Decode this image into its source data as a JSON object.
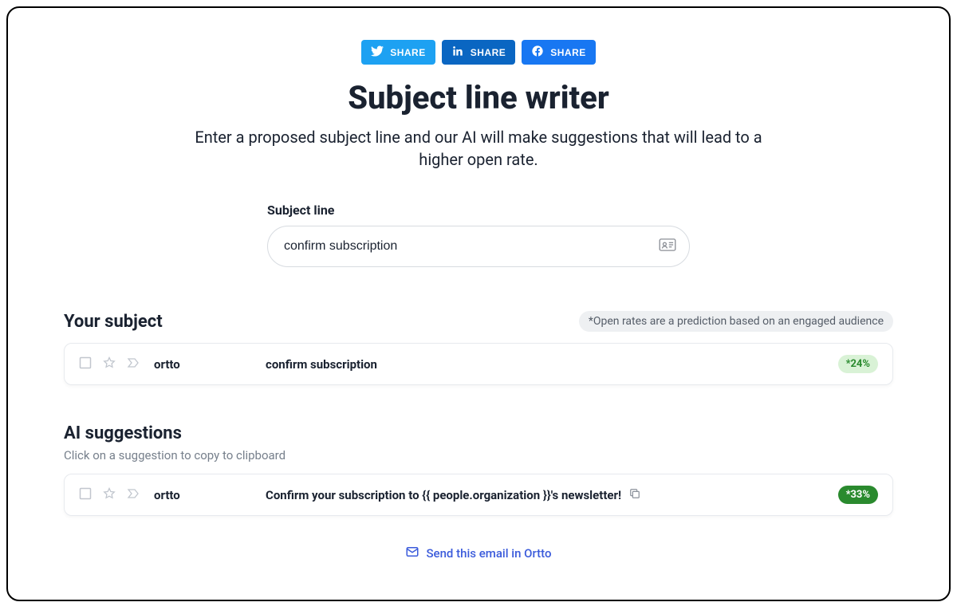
{
  "share": {
    "twitter": "SHARE",
    "linkedin": "SHARE",
    "facebook": "SHARE"
  },
  "header": {
    "title": "Subject line writer",
    "subtitle": "Enter a proposed subject line and our AI will make suggestions that will lead to a higher open rate."
  },
  "input": {
    "label": "Subject line",
    "value": "confirm subscription"
  },
  "your_subject": {
    "heading": "Your subject",
    "note": "*Open rates are a prediction based on an engaged audience",
    "sender": "ortto",
    "subject": "confirm subscription",
    "rate": "*24%"
  },
  "ai": {
    "heading": "AI suggestions",
    "subheading": "Click on a suggestion to copy to clipboard",
    "sender": "ortto",
    "subject": "Confirm your subscription to {{ people.organization }}'s newsletter!",
    "rate": "*33%"
  },
  "footer": {
    "cta": "Send this email in Ortto"
  }
}
